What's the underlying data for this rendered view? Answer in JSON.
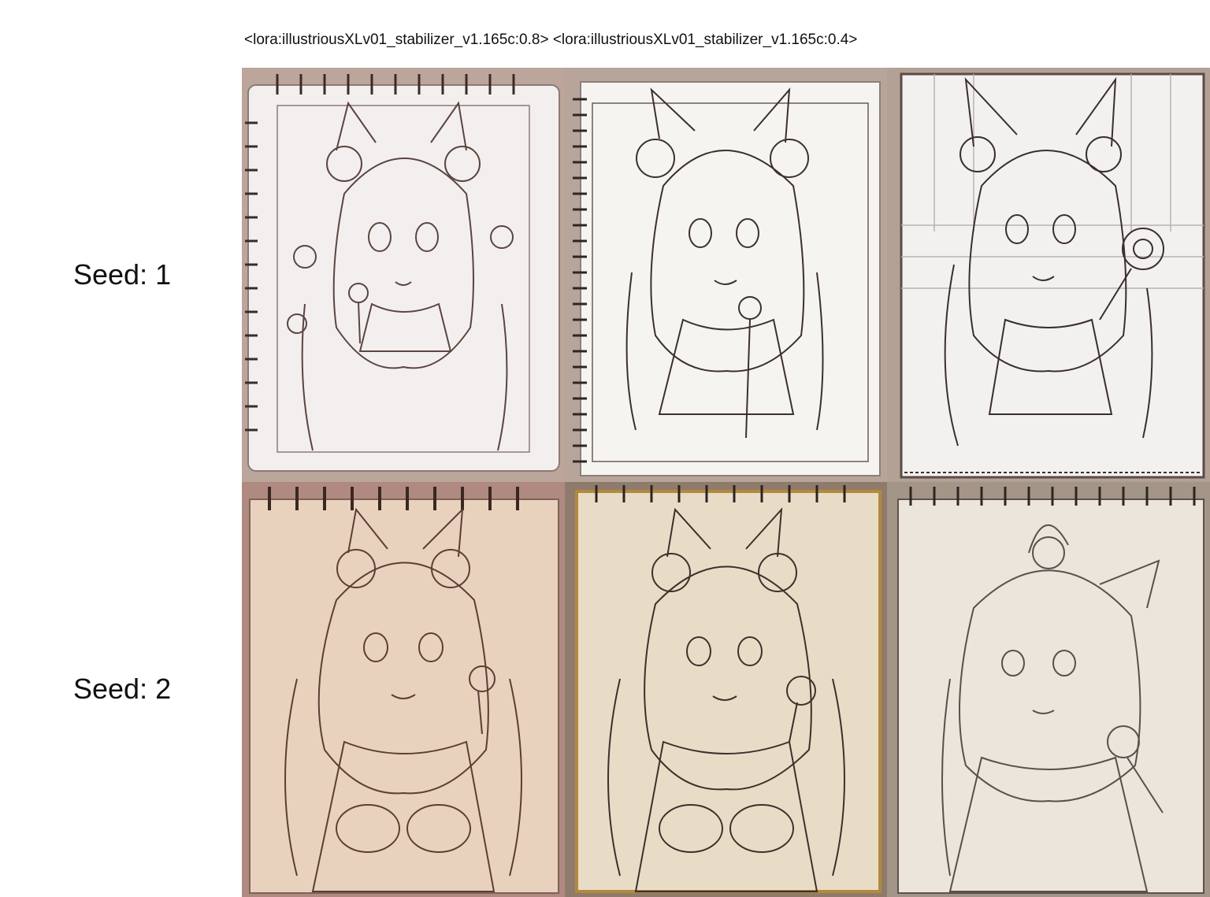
{
  "header": {
    "column_labels": "<lora:illustriousXLv01_stabilizer_v1.165c:0.8> <lora:illustriousXLv01_stabilizer_v1.165c:0.4>"
  },
  "rows": [
    {
      "label": "Seed: 1"
    },
    {
      "label": "Seed: 2"
    }
  ],
  "cells": [
    {
      "row": 0,
      "col": 0,
      "content": "sketchbook-illustration",
      "tone": "#f4efef"
    },
    {
      "row": 0,
      "col": 1,
      "content": "sketchbook-illustration",
      "tone": "#f6f4f1"
    },
    {
      "row": 0,
      "col": 2,
      "content": "sketchbook-illustration",
      "tone": "#f3f1ef"
    },
    {
      "row": 1,
      "col": 0,
      "content": "sketchbook-illustration",
      "tone": "#e8d2bd"
    },
    {
      "row": 1,
      "col": 1,
      "content": "sketchbook-illustration",
      "tone": "#e9dcc7"
    },
    {
      "row": 1,
      "col": 2,
      "content": "sketchbook-illustration",
      "tone": "#ebe5dc"
    }
  ],
  "colors": {
    "background": "#ffffff",
    "text": "#111111",
    "wood": "#b19a8e",
    "sketch_line": "#4a3a36"
  }
}
